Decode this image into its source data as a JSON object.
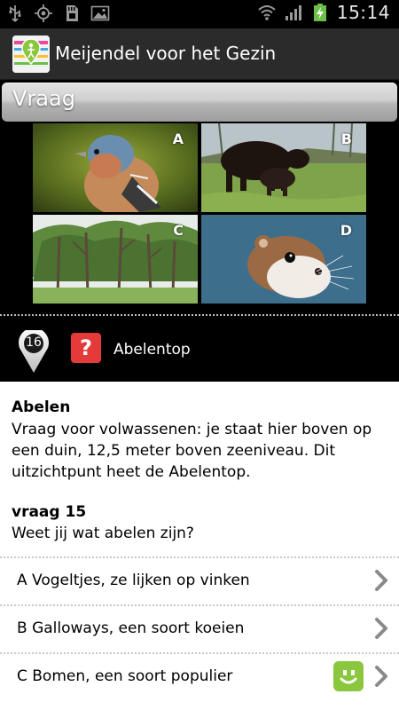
{
  "status_bar": {
    "time": "15:14",
    "icons": [
      "usb-icon",
      "gps-icon",
      "sd-card-icon",
      "image-icon",
      "wifi-icon",
      "signal-icon",
      "battery-charging-icon"
    ]
  },
  "app": {
    "title": "Meijendel voor het Gezin",
    "icon": "app-logo-icon"
  },
  "section": {
    "label": "Vraag"
  },
  "image_grid": [
    {
      "letter": "A",
      "subject": "bird"
    },
    {
      "letter": "B",
      "subject": "cows"
    },
    {
      "letter": "C",
      "subject": "trees"
    },
    {
      "letter": "D",
      "subject": "weasel"
    }
  ],
  "location": {
    "number": "16",
    "icon": "question-icon",
    "name": "Abelentop"
  },
  "intro": {
    "title": "Abelen",
    "text": "Vraag voor volwassenen: je staat hier boven op een duin, 12,5 meter boven zeeniveau. Dit uitzichtpunt heet de Abelentop."
  },
  "question": {
    "title": "vraag 15",
    "text": "Weet jij wat abelen zijn?"
  },
  "answers": [
    {
      "label": "A Vogeltjes, ze lijken op vinken"
    },
    {
      "label": "B Galloways, een soort koeien"
    },
    {
      "label": "C Bomen, een soort populier"
    }
  ],
  "colors": {
    "action_bar": "#2b2b2b",
    "question_badge": "#e53a3a",
    "smile_badge": "#8bc63f"
  }
}
